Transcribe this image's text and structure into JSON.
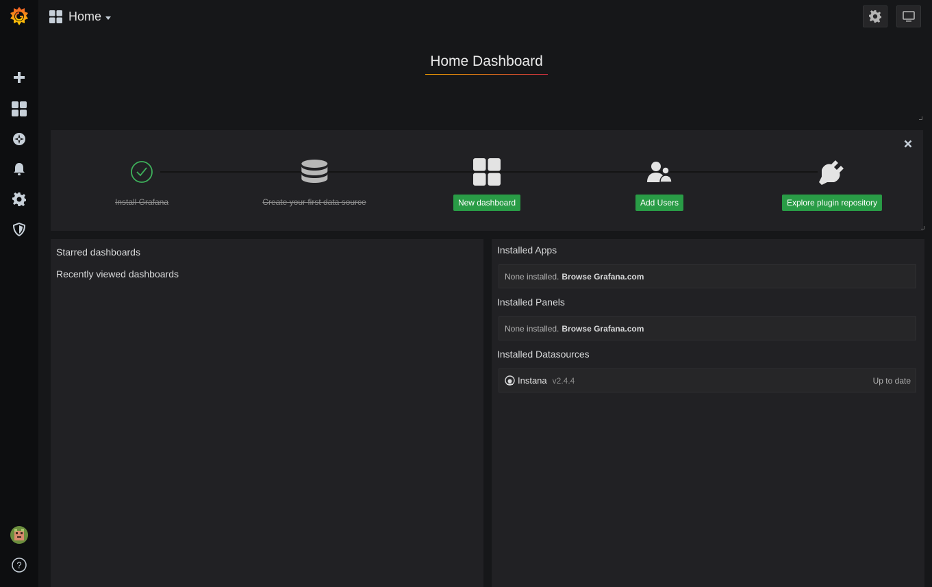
{
  "navbar": {
    "title": "Home",
    "settings_icon": "gear-icon",
    "tv_icon": "monitor-icon"
  },
  "sidebar": {
    "items": [
      {
        "name": "grafana-logo",
        "icon": "grafana-logo"
      },
      {
        "name": "create",
        "icon": "plus-icon"
      },
      {
        "name": "dashboards",
        "icon": "dashboard-grid-icon"
      },
      {
        "name": "explore",
        "icon": "compass-icon"
      },
      {
        "name": "alerting",
        "icon": "bell-icon"
      },
      {
        "name": "configuration",
        "icon": "gear-icon"
      },
      {
        "name": "server-admin",
        "icon": "shield-icon"
      },
      {
        "name": "profile",
        "icon": "avatar"
      },
      {
        "name": "help",
        "icon": "question-icon"
      }
    ]
  },
  "dashboard": {
    "title": "Home Dashboard"
  },
  "getting_started": {
    "steps": [
      {
        "label": "Install Grafana",
        "done": true
      },
      {
        "label": "Create your first data source",
        "done": true
      },
      {
        "label": "New dashboard",
        "done": false
      },
      {
        "label": "Add Users",
        "done": false
      },
      {
        "label": "Explore plugin repository",
        "done": false
      }
    ]
  },
  "left_panel": {
    "starred": "Starred dashboards",
    "recent": "Recently viewed dashboards"
  },
  "right_panel": {
    "apps_title": "Installed Apps",
    "apps_text": "None installed.",
    "apps_link": "Browse Grafana.com",
    "panels_title": "Installed Panels",
    "panels_text": "None installed.",
    "panels_link": "Browse Grafana.com",
    "datasources_title": "Installed Datasources",
    "datasource": {
      "name": "Instana",
      "version": "v2.4.4",
      "status": "Up to date"
    }
  },
  "colors": {
    "accent_green": "#299c46",
    "check_green": "#3eb15b",
    "background": "#161719",
    "panel": "#212124"
  }
}
